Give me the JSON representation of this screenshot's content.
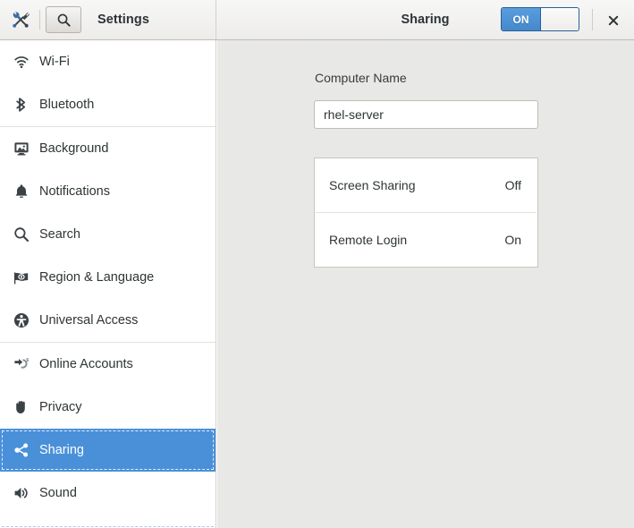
{
  "window": {
    "app_title": "Settings",
    "panel_title": "Sharing"
  },
  "header": {
    "tools_icon": "tools-icon",
    "search_icon": "search-icon",
    "close_icon": "close-icon",
    "sharing_switch": {
      "state_label": "ON",
      "enabled": true,
      "accent_color": "#4a90d9"
    }
  },
  "sidebar": {
    "selected": "Sharing",
    "selected_color": "#4a90d9",
    "groups": [
      {
        "items": [
          {
            "label": "Wi-Fi",
            "icon": "wifi-icon"
          },
          {
            "label": "Bluetooth",
            "icon": "bluetooth-icon"
          }
        ]
      },
      {
        "items": [
          {
            "label": "Background",
            "icon": "background-icon"
          },
          {
            "label": "Notifications",
            "icon": "bell-icon"
          },
          {
            "label": "Search",
            "icon": "search-icon"
          },
          {
            "label": "Region & Language",
            "icon": "flag-icon"
          },
          {
            "label": "Universal Access",
            "icon": "accessibility-icon"
          }
        ]
      },
      {
        "items": [
          {
            "label": "Online Accounts",
            "icon": "online-accounts-icon"
          },
          {
            "label": "Privacy",
            "icon": "hand-icon"
          },
          {
            "label": "Sharing",
            "icon": "share-icon"
          },
          {
            "label": "Sound",
            "icon": "speaker-icon"
          }
        ]
      }
    ]
  },
  "content": {
    "computer_name_label": "Computer Name",
    "computer_name_value": "rhel-server",
    "services": [
      {
        "label": "Screen Sharing",
        "value": "Off"
      },
      {
        "label": "Remote Login",
        "value": "On"
      }
    ]
  }
}
